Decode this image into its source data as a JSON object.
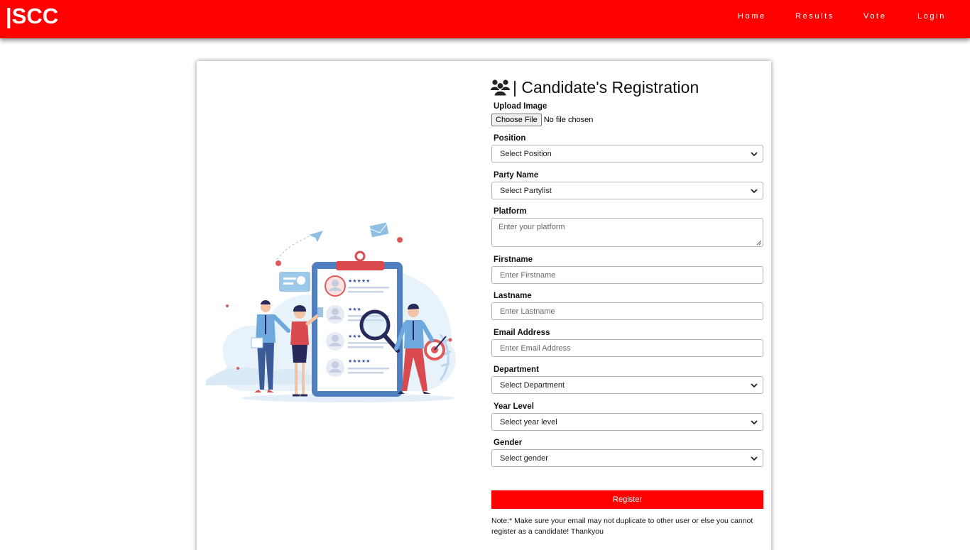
{
  "navbar": {
    "brand": "|SCC",
    "links": [
      "Home",
      "Results",
      "Vote",
      "Login"
    ],
    "background": "#ff0000"
  },
  "form": {
    "title_icon": "users-icon",
    "title": "| Candidate's Registration",
    "upload": {
      "label": "Upload Image",
      "button": "Choose File",
      "status": "No file chosen"
    },
    "position": {
      "label": "Position",
      "value": "Select Position"
    },
    "party": {
      "label": "Party Name",
      "value": "Select Partylist"
    },
    "platform": {
      "label": "Platform",
      "placeholder": "Enter your platform"
    },
    "firstname": {
      "label": "Firstname",
      "placeholder": "Enter Firstname"
    },
    "lastname": {
      "label": "Lastname",
      "placeholder": "Enter Lastname"
    },
    "email": {
      "label": "Email Address",
      "placeholder": "Enter Email Address"
    },
    "department": {
      "label": "Department",
      "value": "Select Department"
    },
    "year_level": {
      "label": "Year Level",
      "value": "Select year level"
    },
    "gender": {
      "label": "Gender",
      "value": "Select gender"
    },
    "register_label": "Register",
    "note": "Note:* Make sure your email may not duplicate to other user or else you cannot register as a candidate! Thankyou"
  }
}
